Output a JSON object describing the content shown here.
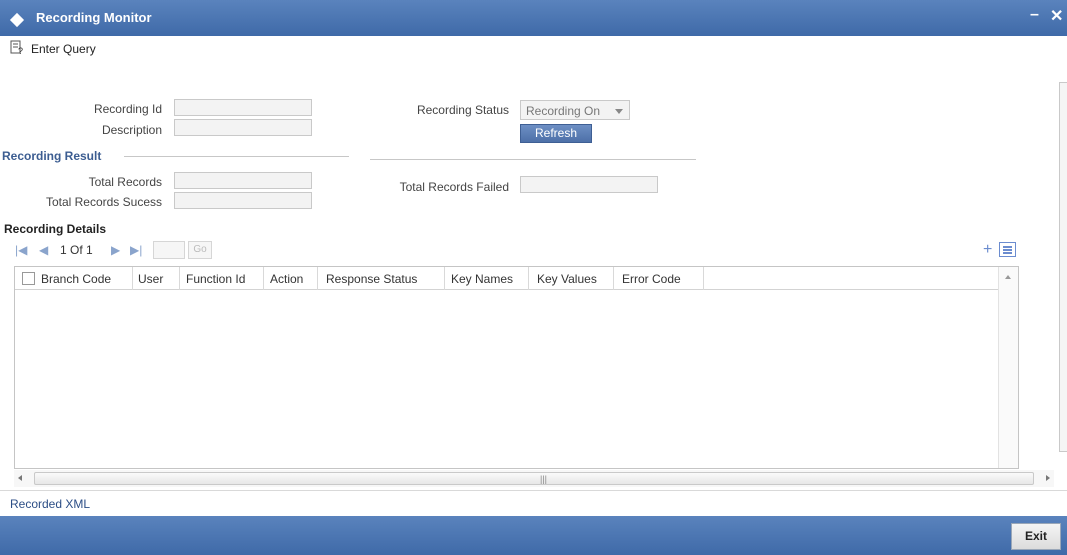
{
  "window": {
    "title": "Recording Monitor",
    "minimize": "–",
    "close": "✕"
  },
  "toolbar": {
    "enter_query": "Enter Query"
  },
  "form": {
    "recording_id_label": "Recording Id",
    "description_label": "Description",
    "recording_status_label": "Recording Status",
    "recording_status_value": "Recording On",
    "refresh_label": "Refresh"
  },
  "result": {
    "section_title": "Recording Result",
    "total_records_label": "Total Records",
    "total_records_success_label": "Total Records Sucess",
    "total_records_failed_label": "Total Records Failed"
  },
  "details": {
    "section_title": "Recording Details",
    "pager": {
      "first": "◀◀",
      "page_text": "1 Of 1",
      "go": "Go"
    },
    "columns": [
      "Branch Code",
      "User",
      "Function Id",
      "Action",
      "Response Status",
      "Key Names",
      "Key Values",
      "Error Code"
    ],
    "rows": []
  },
  "footer": {
    "recorded_xml": "Recorded XML",
    "exit": "Exit"
  },
  "colors": {
    "header_blue": "#4a74b0",
    "accent_text": "#3c5d91"
  }
}
